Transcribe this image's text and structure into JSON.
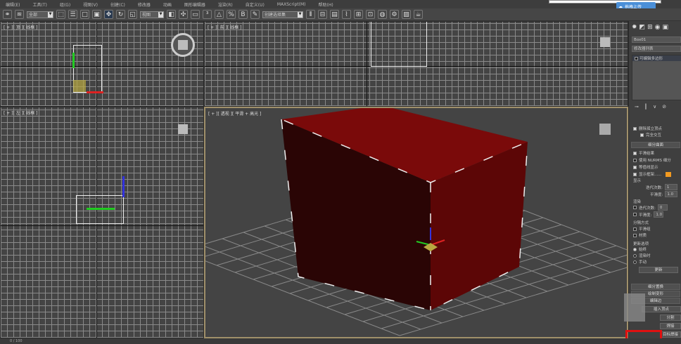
{
  "menu": [
    "编辑(E)",
    "工具(T)",
    "组(G)",
    "视图(V)",
    "创建(C)",
    "修改器",
    "动画",
    "图形编辑器",
    "渲染(R)",
    "自定义(U)",
    "MAXScript(M)",
    "帮助(H)"
  ],
  "upload_label": "拖拽上传",
  "toolbar": {
    "selection_filter": "全部",
    "ref_coord": "视图",
    "named_selection": "创建选择集"
  },
  "viewports": {
    "top": "[ + ][ 顶 ][ 线框 ]",
    "front": "[ + ][ 前 ][ 线框 ]",
    "left": "[ + ][ 左 ][ 线框 ]",
    "perspective": "[ + ][ 透视 ][ 平滑 + 高光 ]"
  },
  "object": {
    "color": "#7a0a0a"
  },
  "command_panel": {
    "object_name": "Box01",
    "modifier_list": "修改器列表",
    "stack_item": "可编辑多边形",
    "delete_isolated": "删除孤立顶点",
    "full_interactivity": "完全交互",
    "subdivision_header": "细分曲面",
    "smooth_result": "平滑结果",
    "use_nurms": "使用 NURMS 细分",
    "isoline": "等值线显示",
    "show_cage": "显示框架......",
    "display": "显示",
    "iterations": "迭代次数:",
    "iter_val": "1",
    "smoothness": "平滑度:",
    "smooth_val": "1.0",
    "render": "渲染",
    "r_iterations": "迭代次数:",
    "r_iter_val": "0",
    "r_smoothness": "平滑度:",
    "r_smooth_val": "1.0",
    "separate_by": "分隔方式",
    "smoothing_groups": "平滑组",
    "materials": "材质",
    "update_options": "更新选项",
    "always": "始终",
    "when_rendering": "渲染时",
    "manually": "手动",
    "update_btn": "更新",
    "subdiv_displacement": "细分置换",
    "paint_deform": "绘制变形",
    "edit_edges": "编辑边",
    "insert_vertex": "插入顶点",
    "split": "分割",
    "weld": "焊接",
    "target_weld": "目标焊接"
  },
  "status": {
    "frame": "0 / 100"
  }
}
